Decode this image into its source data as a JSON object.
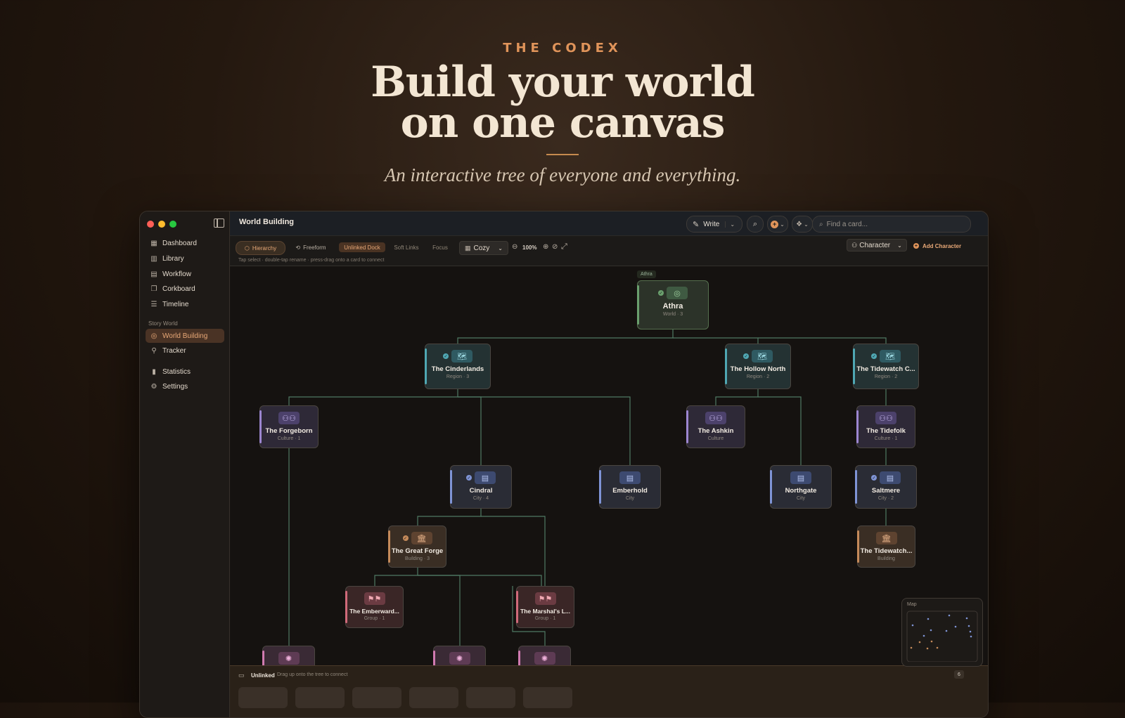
{
  "hero": {
    "eyebrow": "THE CODEX",
    "headline_line1": "Build your world",
    "headline_line2": "on one canvas",
    "subline": "An interactive tree of everyone and everything."
  },
  "window": {
    "title": "World Building",
    "write_label": "Write",
    "search_placeholder": "Find a card..."
  },
  "sidebar": {
    "items": [
      {
        "label": "Dashboard",
        "icon": "grid-icon"
      },
      {
        "label": "Library",
        "icon": "books-icon"
      },
      {
        "label": "Workflow",
        "icon": "columns-icon"
      },
      {
        "label": "Corkboard",
        "icon": "cards-icon"
      },
      {
        "label": "Timeline",
        "icon": "timeline-icon"
      }
    ],
    "section_label": "Story World",
    "world_items": [
      {
        "label": "World Building",
        "icon": "globe-icon",
        "active": true
      },
      {
        "label": "Tracker",
        "icon": "network-icon"
      }
    ],
    "bottom_items": [
      {
        "label": "Statistics",
        "icon": "bar-chart-icon"
      },
      {
        "label": "Settings",
        "icon": "gear-icon"
      }
    ]
  },
  "toolbar": {
    "hierarchy": "Hierarchy",
    "freeform": "Freeform",
    "unlinked_dock": "Unlinked Dock",
    "soft_links": "Soft Links",
    "focus": "Focus",
    "density": "Cozy",
    "zoom": "100%",
    "type_select": "Character",
    "add_label": "Add Character",
    "hint": "Tap select · double-tap rename · press-drag onto a card to connect"
  },
  "canvas": {
    "root_badge": "Athra",
    "cards": [
      {
        "id": "athra",
        "name": "Athra",
        "meta": "World · 3",
        "kind": "world",
        "check": true
      },
      {
        "id": "cinderlands",
        "name": "The Cinderlands",
        "meta": "Region · 3",
        "kind": "region",
        "check": true
      },
      {
        "id": "hollow",
        "name": "The Hollow North",
        "meta": "Region · 2",
        "kind": "region",
        "check": true
      },
      {
        "id": "tidewatch",
        "name": "The Tidewatch C...",
        "meta": "Region · 2",
        "kind": "region",
        "check": true
      },
      {
        "id": "forgeborn",
        "name": "The Forgeborn",
        "meta": "Culture · 1",
        "kind": "culture"
      },
      {
        "id": "ashkin",
        "name": "The Ashkin",
        "meta": "Culture",
        "kind": "culture"
      },
      {
        "id": "tidefolk",
        "name": "The Tidefolk",
        "meta": "Culture · 1",
        "kind": "culture"
      },
      {
        "id": "cindral",
        "name": "Cindral",
        "meta": "City · 4",
        "kind": "city",
        "check": true
      },
      {
        "id": "emberhold",
        "name": "Emberhold",
        "meta": "City",
        "kind": "city"
      },
      {
        "id": "northgate",
        "name": "Northgate",
        "meta": "City",
        "kind": "city"
      },
      {
        "id": "saltmere",
        "name": "Saltmere",
        "meta": "City · 2",
        "kind": "city",
        "check": true
      },
      {
        "id": "greatforge",
        "name": "The Great Forge",
        "meta": "Building · 3",
        "kind": "building",
        "check": true
      },
      {
        "id": "tidewatchb",
        "name": "The Tidewatch...",
        "meta": "Building",
        "kind": "building"
      },
      {
        "id": "emberward",
        "name": "The Emberward...",
        "meta": "Group · 1",
        "kind": "group"
      },
      {
        "id": "marshal",
        "name": "The Marshal's L...",
        "meta": "Group · 1",
        "kind": "group"
      }
    ],
    "minimap_label": "Map"
  },
  "dock": {
    "title": "Unlinked",
    "hint": "Drag up onto the tree to connect",
    "count": "6"
  },
  "colors": {
    "accent": "#e0945a",
    "world": "#6aa06e",
    "region": "#4fa7b3",
    "culture": "#9c86d0",
    "city": "#7f94d6",
    "building": "#c58a5a",
    "group": "#d06a7a",
    "connector": "#4f7a63"
  }
}
